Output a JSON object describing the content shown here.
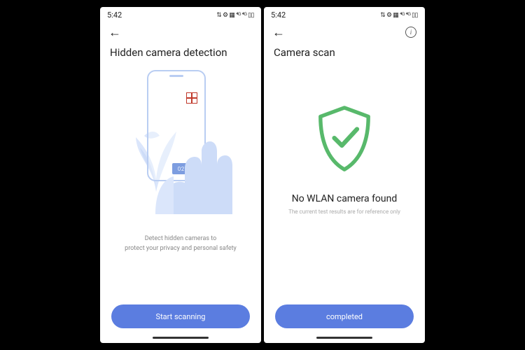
{
  "screen1": {
    "status": {
      "time": "5:42",
      "indicators": "⇅ ⚙ ▦ ⁴ᴳ ⁴ᴳ ▯▯"
    },
    "title": "Hidden camera detection",
    "illustration_time": "02:36",
    "caption_line1": "Detect hidden cameras to",
    "caption_line2": "protect your privacy and personal safety",
    "button": "Start scanning"
  },
  "screen2": {
    "status": {
      "time": "5:42",
      "indicators": "⇅ ⚙ ▦ ⁴ᴳ ⁴ᴳ ▯▯"
    },
    "title": "Camera scan",
    "result_title": "No WLAN camera found",
    "result_sub": "The current test results are for reference only",
    "button": "completed"
  }
}
